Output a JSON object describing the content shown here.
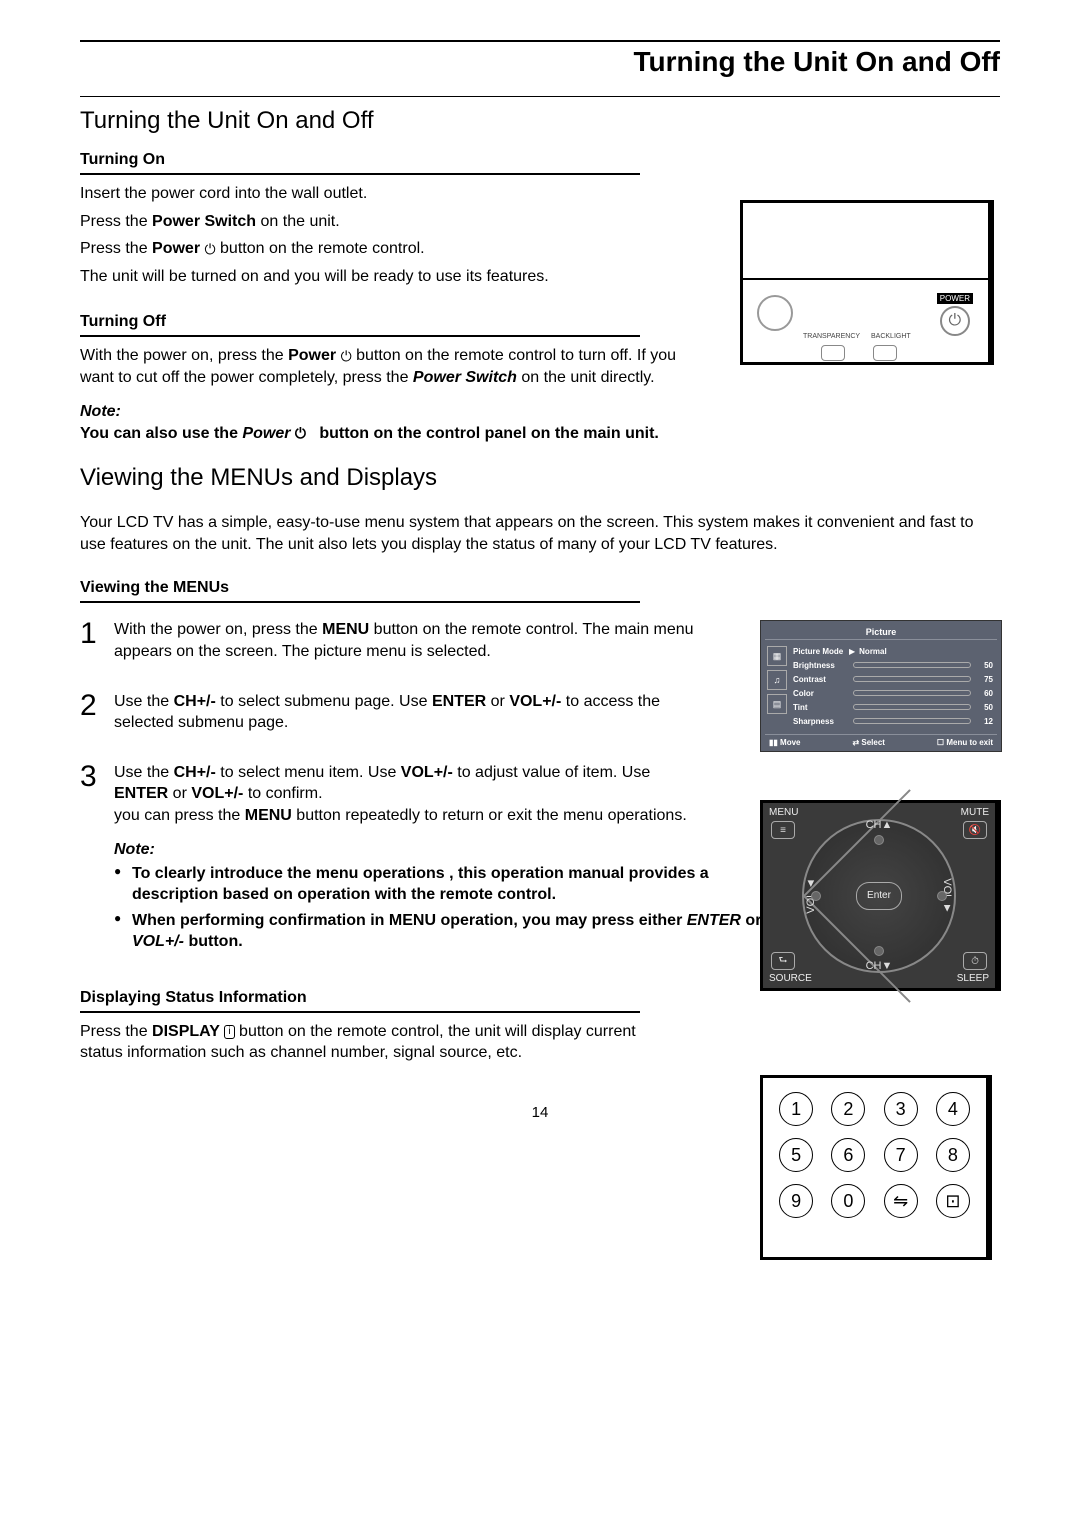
{
  "header": {
    "title": "Turning the Unit On and Off"
  },
  "section1": {
    "heading": "Turning the Unit On and Off",
    "turning_on": {
      "label": "Turning On",
      "line1": "Insert the power cord into the wall outlet.",
      "line2a": "Press the ",
      "line2b": "Power Switch",
      "line2c": " on the unit.",
      "line3a": "Press the ",
      "line3b": "Power",
      "line3c": " button on the remote control.",
      "line4": "The unit will be turned on and you will be ready to use its features."
    },
    "turning_off": {
      "label": "Turning Off",
      "line1a": "With the power on, press the ",
      "line1b": "Power",
      "line1c": " button on the remote control to turn off. If you want to cut off the power completely, press the ",
      "line1d": "Power Switch",
      "line1e": " on the unit directly."
    },
    "note": {
      "label": "Note:",
      "body_a": "You can also use the ",
      "body_b": "Power",
      "body_c": " button on the control panel on the main unit."
    }
  },
  "section2": {
    "heading": "Viewing the MENUs and Displays",
    "intro": "Your LCD TV has a simple, easy-to-use menu system that appears on the screen. This system makes it convenient and fast to use features on the unit. The unit also lets you display the status of many of your LCD TV features.",
    "viewing_label": "Viewing the MENUs",
    "steps": {
      "s1": {
        "num": "1",
        "a": "With the power on, press the ",
        "b": "MENU",
        "c": " button on the remote control. The main menu appears on the screen. The picture menu is selected."
      },
      "s2": {
        "num": "2",
        "a": "Use the ",
        "b": "CH+/-",
        "c": " to select submenu page. Use ",
        "d": "ENTER",
        "e": " or ",
        "f": "VOL+/-",
        "g": " to access the selected submenu page."
      },
      "s3": {
        "num": "3",
        "a": "Use the ",
        "b": "CH+/-",
        "c": " to select menu item. Use ",
        "d": "VOL+/-",
        "e": " to adjust value of item. Use ",
        "f": "ENTER",
        "g": " or ",
        "h": "VOL+/-",
        "i": " to confirm.",
        "j": "you can press the ",
        "k": "MENU",
        "l": " button repeatedly to return or exit the menu operations."
      }
    },
    "note": {
      "label": "Note:",
      "bullet1": "To clearly introduce the menu operations , this operation manual provides a description based on operation with the remote control.",
      "bullet2_a": "When performing confirmation in MENU operation, you may press either ",
      "bullet2_b": "ENTER",
      "bullet2_c": " or ",
      "bullet2_d": "VOL+/-",
      "bullet2_e": " button."
    },
    "status": {
      "label": "Displaying Status Information",
      "line_a": "Press the ",
      "line_b": "DISPLAY",
      "line_c": " button on the remote control, the unit will display current status information such as channel number, signal source, etc."
    }
  },
  "panel": {
    "power": "POWER",
    "transparency": "TRANSPARENCY",
    "backlight": "BACKLIGHT"
  },
  "osd": {
    "title": "Picture",
    "mode_label": "Picture Mode",
    "mode_value": "Normal",
    "rows": [
      {
        "label": "Brightness",
        "val": "50"
      },
      {
        "label": "Contrast",
        "val": "75"
      },
      {
        "label": "Color",
        "val": "60"
      },
      {
        "label": "Tint",
        "val": "50"
      },
      {
        "label": "Sharpness",
        "val": "12"
      }
    ],
    "footer": {
      "move": "Move",
      "select": "Select",
      "exit": "Menu to exit"
    }
  },
  "dpad": {
    "menu": "MENU",
    "mute": "MUTE",
    "source": "SOURCE",
    "sleep": "SLEEP",
    "ch_up": "CH▲",
    "ch_dn": "CH▼",
    "vol_l": "VOL ◄",
    "vol_r": "VOL ►",
    "enter": "Enter"
  },
  "keypad": {
    "keys": [
      "1",
      "2",
      "3",
      "4",
      "5",
      "6",
      "7",
      "8",
      "9",
      "0",
      "⇋",
      "⊡"
    ]
  },
  "page_number": "14"
}
